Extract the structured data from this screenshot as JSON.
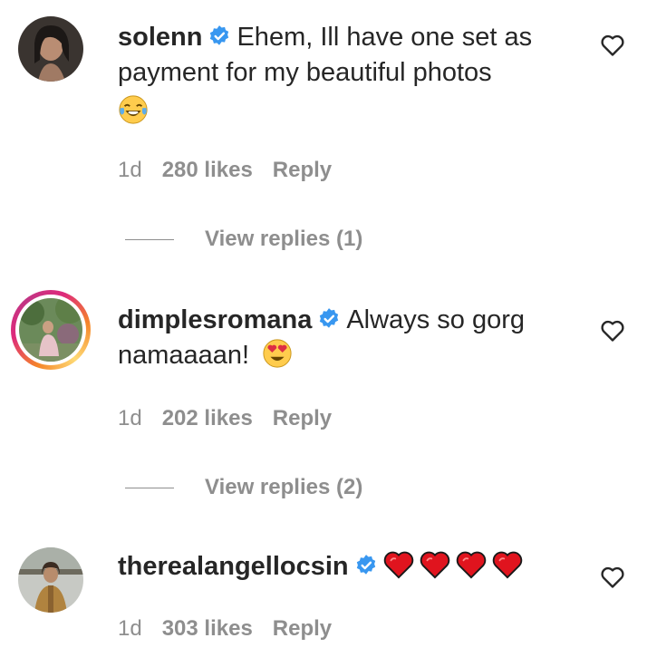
{
  "comments": [
    {
      "username": "solenn",
      "text_line1": "Ehem, Ill have one set as",
      "text_line2": "payment for my beautiful photos",
      "emoji": "laughing-tears",
      "time": "1d",
      "likes": "280 likes",
      "reply": "Reply",
      "view_replies": "View replies (1)"
    },
    {
      "username": "dimplesromana",
      "text_line1": "Always so gorg",
      "text_line2": "namaaaan!",
      "emoji": "heart-eyes",
      "time": "1d",
      "likes": "202 likes",
      "reply": "Reply",
      "view_replies": "View replies (2)"
    },
    {
      "username": "therealangellocsin",
      "emoji": "red-hearts-x4",
      "time": "1d",
      "likes": "303 likes",
      "reply": "Reply"
    }
  ],
  "colors": {
    "verified": "#3897f0",
    "meta_text": "#8e8e8e",
    "heart_emoji": "#e0141e"
  }
}
